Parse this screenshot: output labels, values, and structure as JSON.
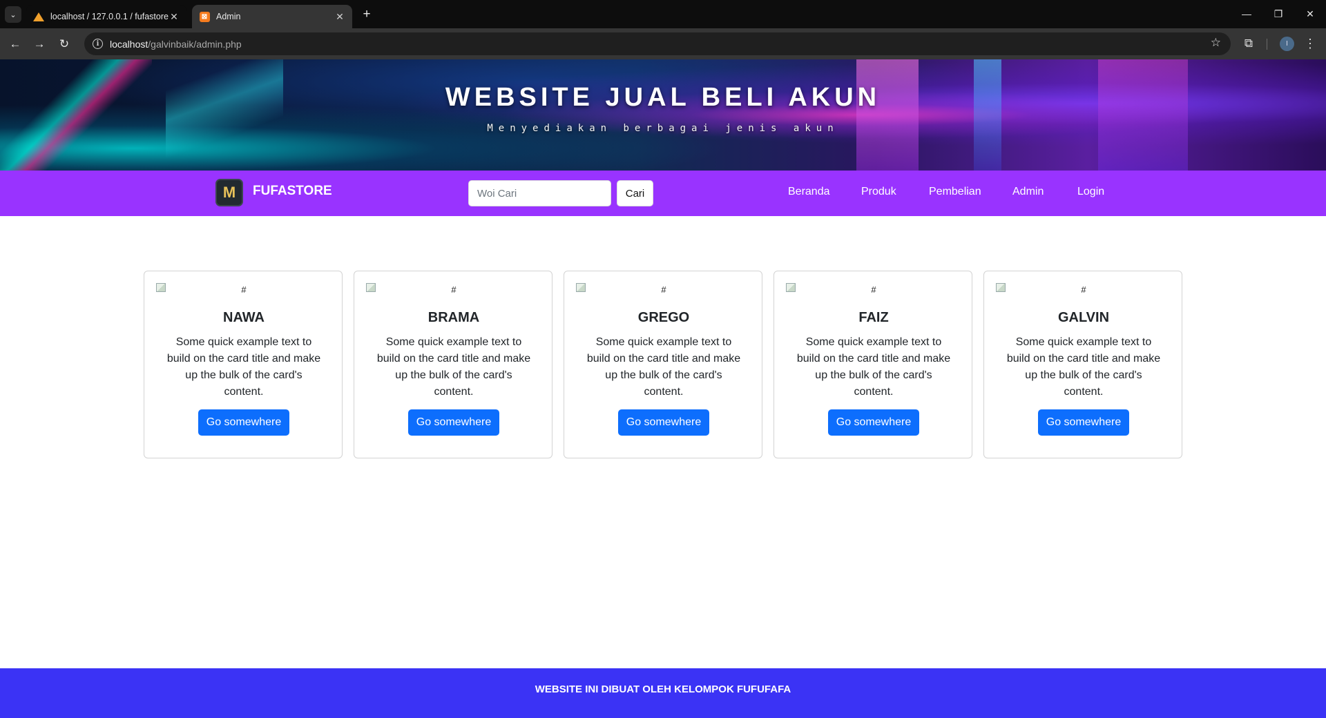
{
  "browser": {
    "tabs": [
      {
        "title": "localhost / 127.0.0.1 / fufastore",
        "active": false
      },
      {
        "title": "Admin",
        "active": true
      }
    ],
    "url": {
      "host": "localhost",
      "path": "/galvinbaik/admin.php"
    },
    "profile_initial": "I"
  },
  "hero": {
    "title": "WEBSITE JUAL BELI AKUN",
    "subtitle": "Menyediakan berbagai jenis akun"
  },
  "navbar": {
    "brand": "FUFASTORE",
    "search_placeholder": "Woi Cari",
    "search_button": "Cari",
    "links": [
      "Beranda",
      "Produk",
      "Pembelian",
      "Admin",
      "Login"
    ]
  },
  "cards": [
    {
      "img_alt": "#",
      "title": "NAWA",
      "text": "Some quick example text to build on the card title and make up the bulk of the card's content.",
      "button": "Go somewhere"
    },
    {
      "img_alt": "#",
      "title": "BRAMA",
      "text": "Some quick example text to build on the card title and make up the bulk of the card's content.",
      "button": "Go somewhere"
    },
    {
      "img_alt": "#",
      "title": "GREGO",
      "text": "Some quick example text to build on the card title and make up the bulk of the card's content.",
      "button": "Go somewhere"
    },
    {
      "img_alt": "#",
      "title": "FAIZ",
      "text": "Some quick example text to build on the card title and make up the bulk of the card's content.",
      "button": "Go somewhere"
    },
    {
      "img_alt": "#",
      "title": "GALVIN",
      "text": "Some quick example text to build on the card title and make up the bulk of the card's content.",
      "button": "Go somewhere"
    }
  ],
  "footer": {
    "text": "WEBSITE INI DIBUAT OLEH KELOMPOK FUFUFAFA"
  },
  "colors": {
    "navbar": "#9933ff",
    "primary_button": "#0d6efd",
    "footer": "#3b33f5"
  }
}
